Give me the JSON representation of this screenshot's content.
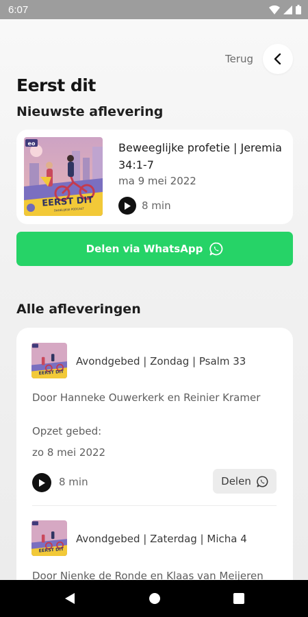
{
  "status_bar": {
    "time": "6:07"
  },
  "header": {
    "back_label": "Terug",
    "title": "Eerst dit"
  },
  "latest": {
    "section_title": "Nieuwste aflevering",
    "episode_title": "Beweeglijke profetie | Jeremia 34:1-7",
    "date": "ma 9 mei 2022",
    "duration": "8 min",
    "cover": {
      "brand": "eo",
      "show_title": "EERST DIT",
      "show_subtitle": "DAGELIJKSE PODCAST"
    }
  },
  "share_whatsapp": {
    "label": "Delen via WhatsApp"
  },
  "all_episodes": {
    "section_title": "Alle afleveringen",
    "episodes": [
      {
        "title": "Avondgebed | Zondag | Psalm 33",
        "authors": "Door Hanneke Ouwerkerk en Reinier Kramer",
        "note": "Opzet gebed:",
        "date": "zo 8 mei 2022",
        "duration": "8 min",
        "share_label": "Delen"
      },
      {
        "title": "Avondgebed | Zaterdag | Micha 4",
        "authors": "Door Nienke de Ronde en Klaas van Meijeren"
      }
    ]
  },
  "colors": {
    "whatsapp_green": "#26d367",
    "cover_yellow": "#f2c938",
    "cover_pink": "#e8a6ae",
    "cover_purple": "#6f6ab8"
  },
  "icons": {
    "back": "chevron-left-icon",
    "play": "play-icon",
    "whatsapp": "whatsapp-icon",
    "nav": [
      "nav-back-icon",
      "nav-home-icon",
      "nav-recents-icon"
    ]
  }
}
